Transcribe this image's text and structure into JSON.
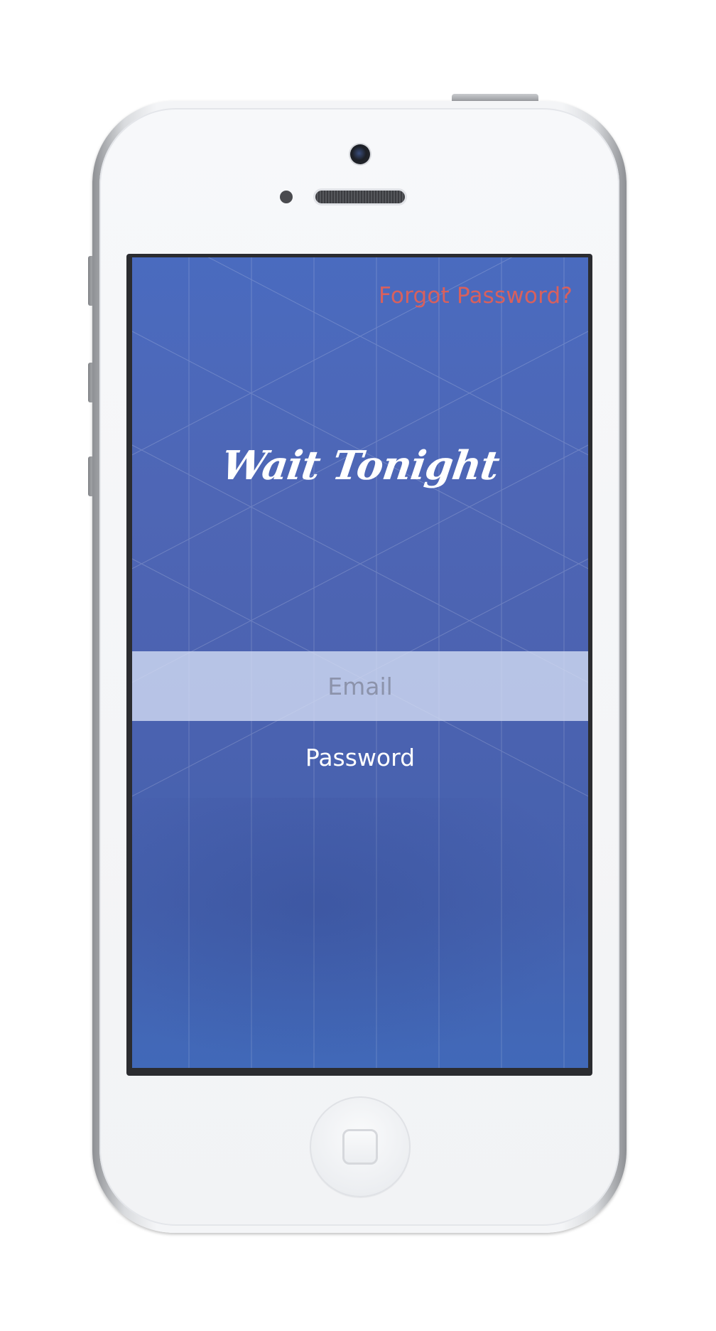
{
  "app": {
    "title": "Wait Tonight"
  },
  "header": {
    "forgot_password_label": "Forgot Password?"
  },
  "login_form": {
    "email_placeholder": "Email",
    "password_placeholder": "Password"
  },
  "colors": {
    "screen_background": "#4b62b0",
    "forgot_link": "#d8605d",
    "email_field_background": "#d6dff5",
    "email_placeholder": "#8c93ab",
    "title_text": "#ffffff"
  }
}
